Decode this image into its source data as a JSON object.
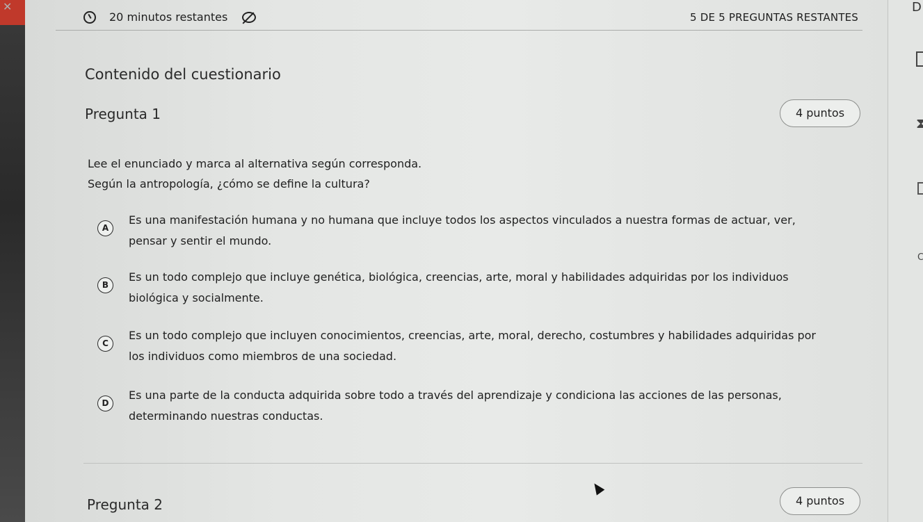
{
  "header": {
    "timer_text": "20 minutos restantes",
    "remaining_text": "5 DE 5 PREGUNTAS RESTANTES"
  },
  "section": {
    "title": "Contenido del cuestionario"
  },
  "question1": {
    "title": "Pregunta 1",
    "points": "4 puntos",
    "instruction": "Lee el enunciado y marca al alternativa según corresponda.",
    "prompt": "Según la antropología, ¿cómo se define la cultura?",
    "options": [
      {
        "letter": "A",
        "line1": "Es una manifestación humana y no humana que incluye todos los aspectos vinculados a nuestra formas de actuar, ver,",
        "line2": "pensar y sentir el mundo."
      },
      {
        "letter": "B",
        "line1": "Es un todo complejo que incluye genética, biológica, creencias, arte, moral y habilidades adquiridas por los individuos",
        "line2": "biológica y socialmente."
      },
      {
        "letter": "C",
        "line1": "Es un todo complejo que incluyen conocimientos, creencias, arte, moral, derecho, costumbres y habilidades adquiridas por",
        "line2": "los individuos como miembros de una sociedad."
      },
      {
        "letter": "D",
        "line1": "Es una parte de la conducta adquirida sobre todo a través del aprendizaje y condiciona las acciones de las personas,",
        "line2": "determinando nuestras conductas."
      }
    ]
  },
  "question2": {
    "title": "Pregunta 2",
    "points": "4 puntos"
  },
  "right_rail": {
    "top_letter": "D",
    "side_letter": "C"
  },
  "icons": {
    "timer": "timer-icon",
    "eye_off": "eye-off-icon",
    "close": "close-icon",
    "cursor": "mouse-cursor-icon"
  },
  "colors": {
    "accent_red": "#c0392b"
  }
}
